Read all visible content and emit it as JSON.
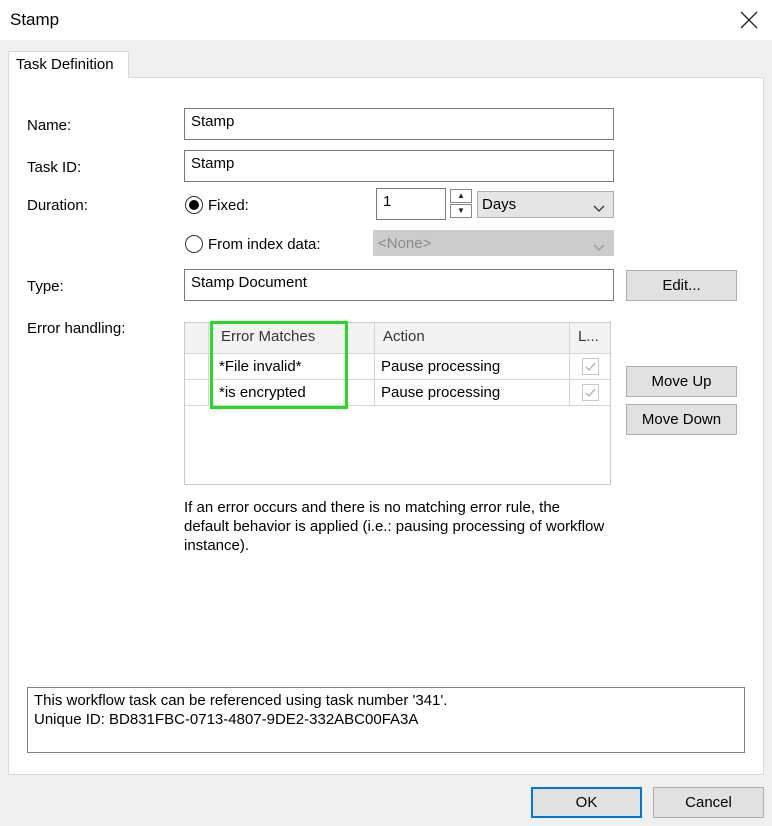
{
  "window": {
    "title": "Stamp"
  },
  "tabs": [
    {
      "label": "Task Definition"
    }
  ],
  "form": {
    "name_label": "Name:",
    "name_value": "Stamp",
    "taskid_label": "Task ID:",
    "taskid_value": "Stamp",
    "duration_label": "Duration:",
    "fixed_label": "Fixed:",
    "fixed_checked": true,
    "duration_value": "1",
    "duration_unit": "Days",
    "from_index_label": "From index data:",
    "from_index_value": "<None>",
    "type_label": "Type:",
    "type_value": "Stamp Document",
    "edit_button": "Edit...",
    "error_label": "Error handling:"
  },
  "error_grid": {
    "columns": [
      "Error Matches",
      "Action",
      "L..."
    ],
    "rows": [
      {
        "match": "*File invalid*",
        "action": "Pause processing",
        "checked": true
      },
      {
        "match": "*is encrypted",
        "action": "Pause processing",
        "checked": true
      }
    ]
  },
  "buttons": {
    "move_up": "Move Up",
    "move_down": "Move Down",
    "ok": "OK",
    "cancel": "Cancel"
  },
  "note": "If an error occurs and there is no matching error rule, the default behavior is applied (i.e.: pausing processing of workflow instance).",
  "info": {
    "line1": "This workflow task can be referenced using task number '341'.",
    "line2": "Unique ID: BD831FBC-0713-4807-9DE2-332ABC00FA3A"
  },
  "colors": {
    "highlight": "#22dd22",
    "default_button_border": "#0078d7"
  }
}
